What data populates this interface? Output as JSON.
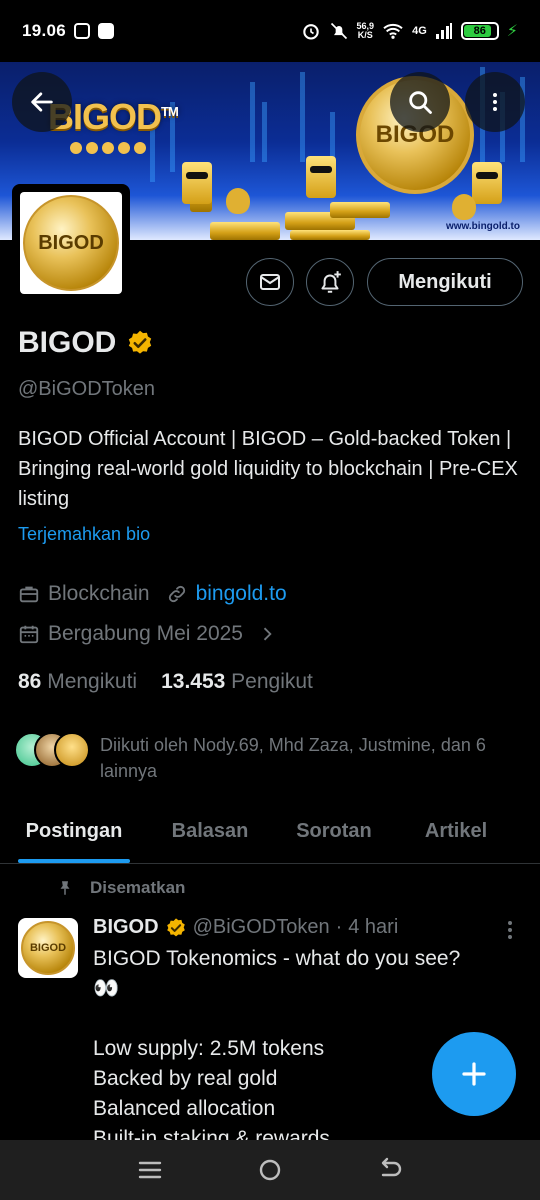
{
  "status_bar": {
    "time": "19.06",
    "network_speed_value": "56,9",
    "network_speed_unit": "K/S",
    "network_type": "4G",
    "battery": "86"
  },
  "banner": {
    "logo_text": "BIGOD",
    "trademark": "TM",
    "coin_text": "BIGOD",
    "url": "www.bingold.to"
  },
  "profile": {
    "avatar_text": "BIGOD",
    "display_name": "BIGOD",
    "handle": "@BiGODToken",
    "bio": "BIGOD Official Account | BIGOD – Gold-backed Token | Bringing real-world gold liquidity to blockchain | Pre-CEX listing",
    "translate_label": "Terjemahkan bio",
    "category": "Blockchain",
    "website": "bingold.to",
    "joined": "Bergabung Mei 2025",
    "following_count": "86",
    "following_label": "Mengikuti",
    "followers_count": "13.453",
    "followers_label": "Pengikut",
    "followed_by": "Diikuti oleh Nody.69, Mhd Zaza, Justmine, dan 6 lainnya",
    "follow_button": "Mengikuti"
  },
  "tabs": [
    "Postingan",
    "Balasan",
    "Sorotan",
    "Artikel"
  ],
  "pinned_post": {
    "pinned_label": "Disematkan",
    "author_name": "BIGOD",
    "author_handle": "@BiGODToken",
    "separator": "·",
    "time": "4 hari",
    "avatar_text": "BIGOD",
    "body": "BIGOD Tokenomics - what do you see?\n👀\n\nLow supply: 2.5M tokens\nBacked by real gold\nBalanced allocation\nBuilt-in staking & rewards"
  },
  "colors": {
    "accent": "#1d9bf0",
    "verified_badge": "#f4b400",
    "text_primary": "#e7e9ea",
    "text_secondary": "#71767b",
    "background": "#000000"
  },
  "icons": [
    "back-arrow-icon",
    "search-icon",
    "more-vertical-icon",
    "mail-icon",
    "bell-plus-icon",
    "verified-badge-icon",
    "briefcase-icon",
    "link-icon",
    "calendar-icon",
    "chevron-right-icon",
    "pin-icon",
    "plus-icon"
  ]
}
